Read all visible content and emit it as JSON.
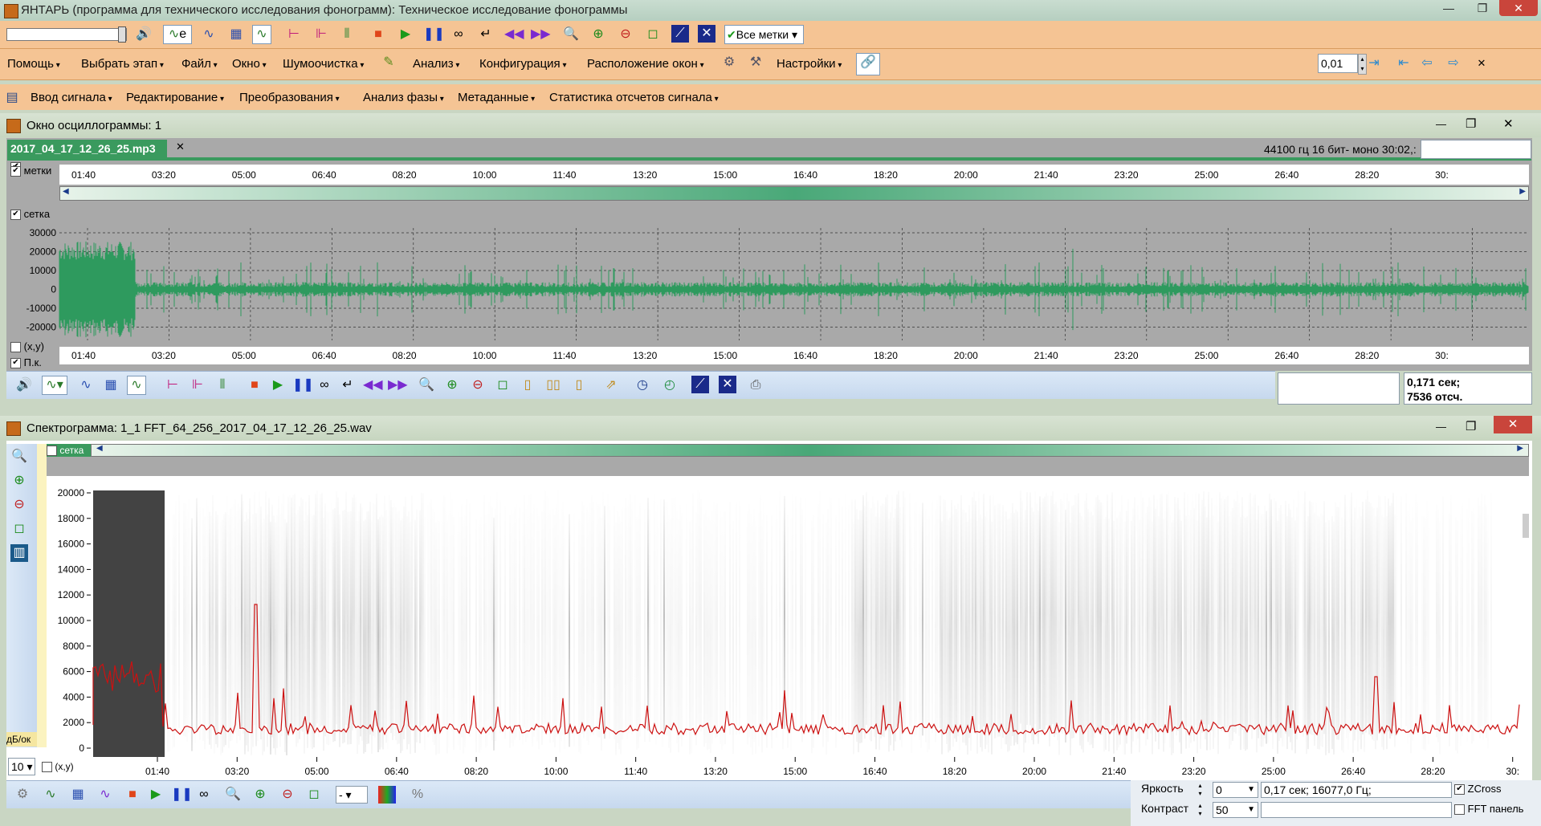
{
  "window": {
    "title": "ЯНТАРЬ (программа для технического исследования фонограмм): Техническое исследование фонограммы"
  },
  "toolbar1": {
    "marks_label": "Все метки",
    "mode_label": "е"
  },
  "menubar": {
    "items": [
      "Помощь",
      "Выбрать этап",
      "Файл",
      "Окно",
      "Шумоочистка",
      "Анализ",
      "Конфигурация",
      "Расположение окон",
      "Настройки"
    ],
    "step_value": "0,01"
  },
  "menubar2": {
    "items": [
      "Ввод сигнала",
      "Редактирование",
      "Преобразования",
      "Анализ фазы",
      "Метаданные",
      "Статистика отсчетов сигнала"
    ]
  },
  "oscillogram": {
    "title": "Окно осциллограммы: 1",
    "file_tab": "2017_04_17_12_26_25.mp3",
    "file_info": "44100 гц 16 бит- моно 30:02,:",
    "labels": {
      "marks": "метки",
      "grid": "сетка",
      "xy": "(x,y)",
      "pk": "П.к."
    },
    "time_ticks": [
      "01:40",
      "03:20",
      "05:00",
      "06:40",
      "08:20",
      "10:00",
      "11:40",
      "13:20",
      "15:00",
      "16:40",
      "18:20",
      "20:00",
      "21:40",
      "23:20",
      "25:00",
      "26:40",
      "28:20",
      "30:"
    ],
    "amp_ticks": [
      "30000",
      "20000",
      "10000",
      "0",
      "-10000",
      "-20000"
    ],
    "readout_time": "0,171 сек;",
    "readout_samples": "7536 отсч."
  },
  "spectrogram": {
    "title": "Спектрограмма: 1_1  FFT_64_256_2017_04_17_12_26_25.wav",
    "grid_label": "сетка",
    "xy_label": "(x,y)",
    "db_label": "дБ/ок",
    "zoom_value": "10",
    "freq_ticks": [
      "20000",
      "18000",
      "16000",
      "14000",
      "12000",
      "10000",
      "8000",
      "6000",
      "4000",
      "2000",
      "0"
    ],
    "time_ticks": [
      "01:40",
      "03:20",
      "05:00",
      "06:40",
      "08:20",
      "10:00",
      "11:40",
      "13:20",
      "15:00",
      "16:40",
      "18:20",
      "20:00",
      "21:40",
      "23:20",
      "25:00",
      "26:40",
      "28:20",
      "30:"
    ],
    "brightness_label": "Яркость",
    "brightness_value": "0",
    "contrast_label": "Контраст",
    "contrast_value": "50",
    "cursor_readout": "0,17 сек; 16077,0 Гц;",
    "zcross_label": "ZCross",
    "fft_panel_label": "FFT панель",
    "dropdown_value": "-"
  },
  "colors": {
    "accent": "#f5c494",
    "signal": "#2e9a5e",
    "curve": "#cc1111",
    "pane": "#a9a9a9"
  }
}
